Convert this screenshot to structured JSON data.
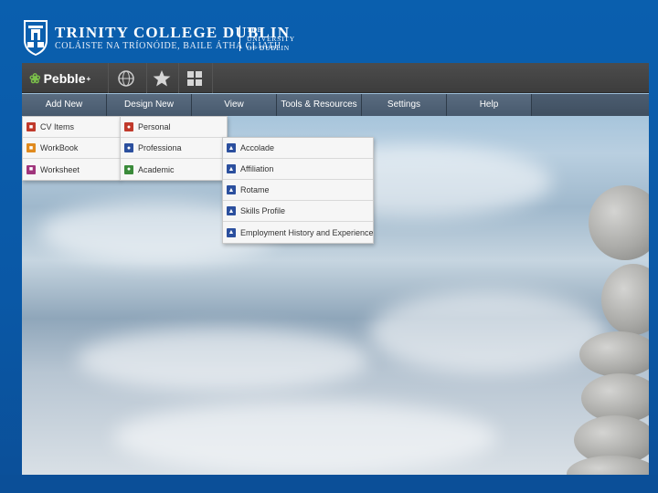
{
  "header": {
    "title": "TRINITY COLLEGE DUBLIN",
    "subtitle": "COLÁISTE NA TRÍONÓIDE, BAILE ÁTHA CLIATH",
    "right_line1": "THE",
    "right_line2": "UNIVERSITY",
    "right_line3": "OF DUBLIN"
  },
  "toolbar": {
    "logo_label": "Pebble",
    "logo_sup": "+",
    "icons": [
      "globe-icon",
      "star-icon",
      "grid-icon"
    ]
  },
  "nav": {
    "items": [
      "Add New",
      "Design New",
      "View",
      "Tools & Resources",
      "Settings",
      "Help"
    ]
  },
  "menus": {
    "add_new": [
      {
        "label": "CV Items",
        "icon": "cv-icon",
        "color": "#c0392b"
      },
      {
        "label": "WorkBook",
        "icon": "workbook-icon",
        "color": "#e08a1e"
      },
      {
        "label": "Worksheet",
        "icon": "worksheet-icon",
        "color": "#a0357c"
      }
    ],
    "design_new": [
      {
        "label": "Personal",
        "icon": "person-icon",
        "color": "#c0392b"
      },
      {
        "label": "Professiona",
        "icon": "professional-icon",
        "color": "#2b4f9e"
      },
      {
        "label": "Academic",
        "icon": "academic-icon",
        "color": "#3a8a3a"
      }
    ],
    "professional_sub": [
      {
        "label": "Accolade",
        "icon": "accolade-icon",
        "color": "#2b4f9e"
      },
      {
        "label": "Affiliation",
        "icon": "affiliation-icon",
        "color": "#2b4f9e"
      },
      {
        "label": "Rotame",
        "icon": "rotame-icon",
        "color": "#2b4f9e"
      },
      {
        "label": "Skills Profile",
        "icon": "skills-icon",
        "color": "#2b4f9e"
      },
      {
        "label": "Employment History and Experience",
        "icon": "employment-icon",
        "color": "#2b4f9e"
      }
    ]
  },
  "colors": {
    "background": "#0a5fae",
    "toolbar": "#444444",
    "nav": "#4f6175"
  }
}
